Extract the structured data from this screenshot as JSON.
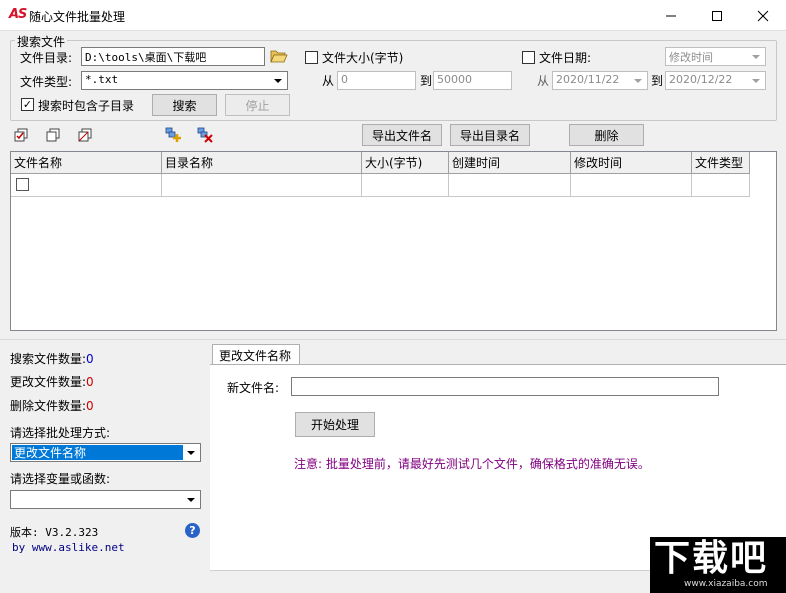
{
  "window": {
    "logo": "AS",
    "title": "随心文件批量处理"
  },
  "search": {
    "group_title": "搜索文件",
    "dir_label": "文件目录:",
    "dir_value": "D:\\tools\\桌面\\下载吧",
    "type_label": "文件类型:",
    "type_value": "*.txt",
    "size_label": "文件大小(字节)",
    "size_from_label": "从",
    "size_from": "0",
    "size_to_label": "到",
    "size_to": "50000",
    "date_label": "文件日期:",
    "date_mode": "修改时间",
    "date_from_label": "从",
    "date_from": "2020/11/22",
    "date_to_label": "到",
    "date_to": "2020/12/22",
    "subdir_label": "搜索时包含子目录",
    "search_btn": "搜索",
    "stop_btn": "停止"
  },
  "toolbar": {
    "export_files": "导出文件名",
    "export_dirs": "导出目录名",
    "delete": "删除"
  },
  "table": {
    "columns": [
      "文件名称",
      "目录名称",
      "大小(字节)",
      "创建时间",
      "修改时间",
      "文件类型"
    ]
  },
  "stats": {
    "searched_label": "搜索文件数量:",
    "searched": "0",
    "changed_label": "更改文件数量:",
    "changed": "0",
    "deleted_label": "删除文件数量:",
    "deleted": "0"
  },
  "mode": {
    "label": "请选择批处理方式:",
    "value": "更改文件名称"
  },
  "var": {
    "label": "请选择变量或函数:",
    "value": ""
  },
  "about": {
    "version": "版本: V3.2.323",
    "by": "by www.aslike.net"
  },
  "tab": {
    "title": "更改文件名称",
    "new_name_label": "新文件名:",
    "new_name_value": "",
    "start_btn": "开始处理",
    "notice": "注意: 批量处理前，请最好先测试几个文件，确保格式的准确无误。"
  },
  "watermark": {
    "big": "下载吧",
    "url": "www.xiazaiba.com"
  },
  "colors": {
    "count_blue": "#0000cc",
    "count_red": "#cc0000",
    "notice_purple": "#800080",
    "select_blue": "#0078d7",
    "by_blue": "#000080"
  }
}
